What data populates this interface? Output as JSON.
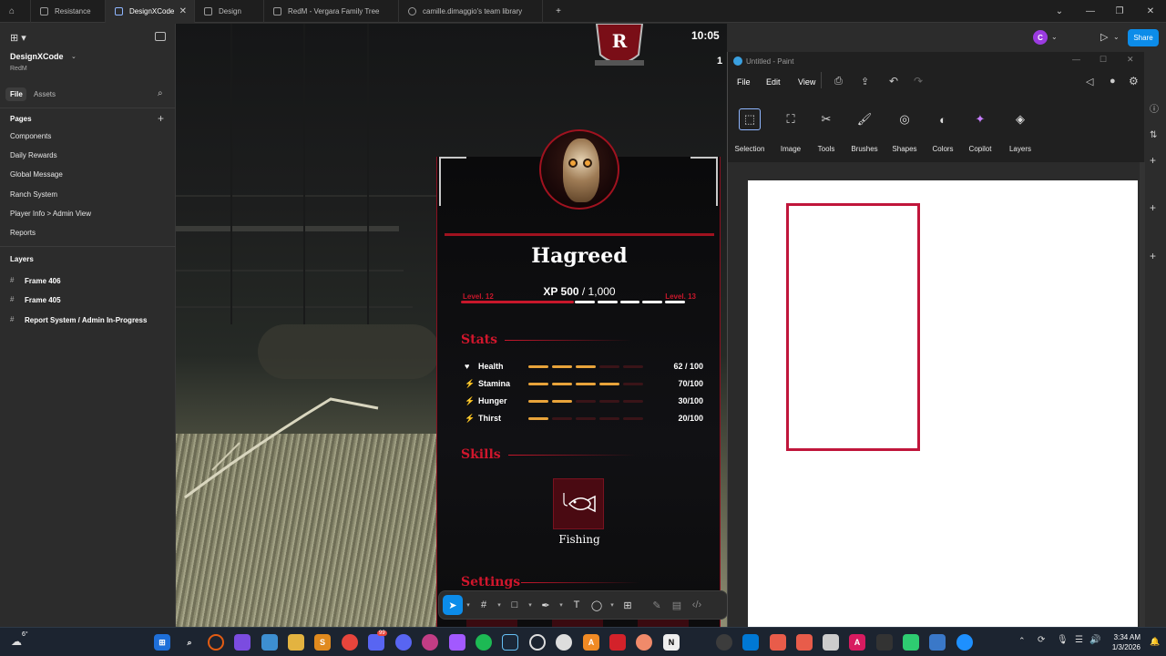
{
  "tabs": [
    {
      "label": "Resistance",
      "active": false
    },
    {
      "label": "DesignXCode",
      "active": true
    },
    {
      "label": "Design",
      "active": false
    },
    {
      "label": "RedM - Vergara Family Tree",
      "active": false
    },
    {
      "label": "camille.dimaggio's team library",
      "active": false
    }
  ],
  "tab_add": "+",
  "left": {
    "project_name": "DesignXCode",
    "project_sub": "RedM",
    "tab_file": "File",
    "tab_assets": "Assets",
    "pages_heading": "Pages",
    "pages_add": "+",
    "pages": [
      "Components",
      "Daily Rewards",
      "Global Message",
      "Ranch System",
      "Player Info > Admin View",
      "Reports"
    ],
    "layers_heading": "Layers",
    "layers": [
      "Frame 406",
      "Frame 405",
      "Report System / Admin In-Progress"
    ]
  },
  "hud": {
    "time": "10:05",
    "side_num": "1"
  },
  "card": {
    "name": "Hagreed",
    "level_left": "Level. 12",
    "level_right": "Level. 13",
    "xp_current": "XP 500",
    "xp_total": "/ 1,000",
    "xp_progress": 0.5,
    "stats_title": "Stats",
    "stats": [
      {
        "label": "Health",
        "icon": "heart-icon",
        "glyph": "♥",
        "value": "62 / 100",
        "fraction": 0.62
      },
      {
        "label": "Stamina",
        "icon": "bolt-icon",
        "glyph": "⚡",
        "value": "70/100",
        "fraction": 0.7
      },
      {
        "label": "Hunger",
        "icon": "bolt-icon",
        "glyph": "⚡",
        "value": "30/100",
        "fraction": 0.3
      },
      {
        "label": "Thirst",
        "icon": "bolt-icon",
        "glyph": "⚡",
        "value": "20/100",
        "fraction": 0.2
      }
    ],
    "skills_title": "Skills",
    "skill": {
      "label": "Fishing",
      "icon": "fish-icon"
    },
    "settings_title": "Settings"
  },
  "figma": {
    "share": "Share",
    "avatar": "C"
  },
  "paint": {
    "title": "Untitled - Paint",
    "menu": [
      "File",
      "Edit",
      "View"
    ],
    "tools": [
      "Selection",
      "Image",
      "Tools",
      "Brushes",
      "Shapes",
      "Colors",
      "Copilot",
      "Layers"
    ]
  },
  "taskbar": {
    "weather": "6°",
    "time": "3:34 AM",
    "date": "1/3/2026",
    "badge": "99"
  },
  "colors": {
    "accent": "#0c8ce9",
    "card_red": "#c8172b",
    "stat_orange": "#e8a33a",
    "paint_rect": "#c0163b"
  }
}
